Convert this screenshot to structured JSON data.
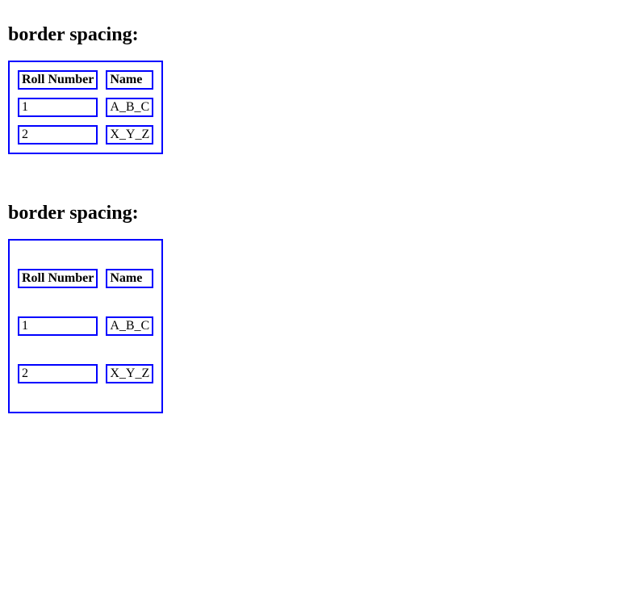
{
  "section1": {
    "heading": "border spacing:",
    "table": {
      "headers": [
        "Roll Number",
        "Name"
      ],
      "rows": [
        [
          "1",
          "A_B_C"
        ],
        [
          "2",
          "X_Y_Z"
        ]
      ]
    }
  },
  "section2": {
    "heading": "border spacing:",
    "table": {
      "headers": [
        "Roll Number",
        "Name"
      ],
      "rows": [
        [
          "1",
          "A_B_C"
        ],
        [
          "2",
          "X_Y_Z"
        ]
      ]
    }
  }
}
